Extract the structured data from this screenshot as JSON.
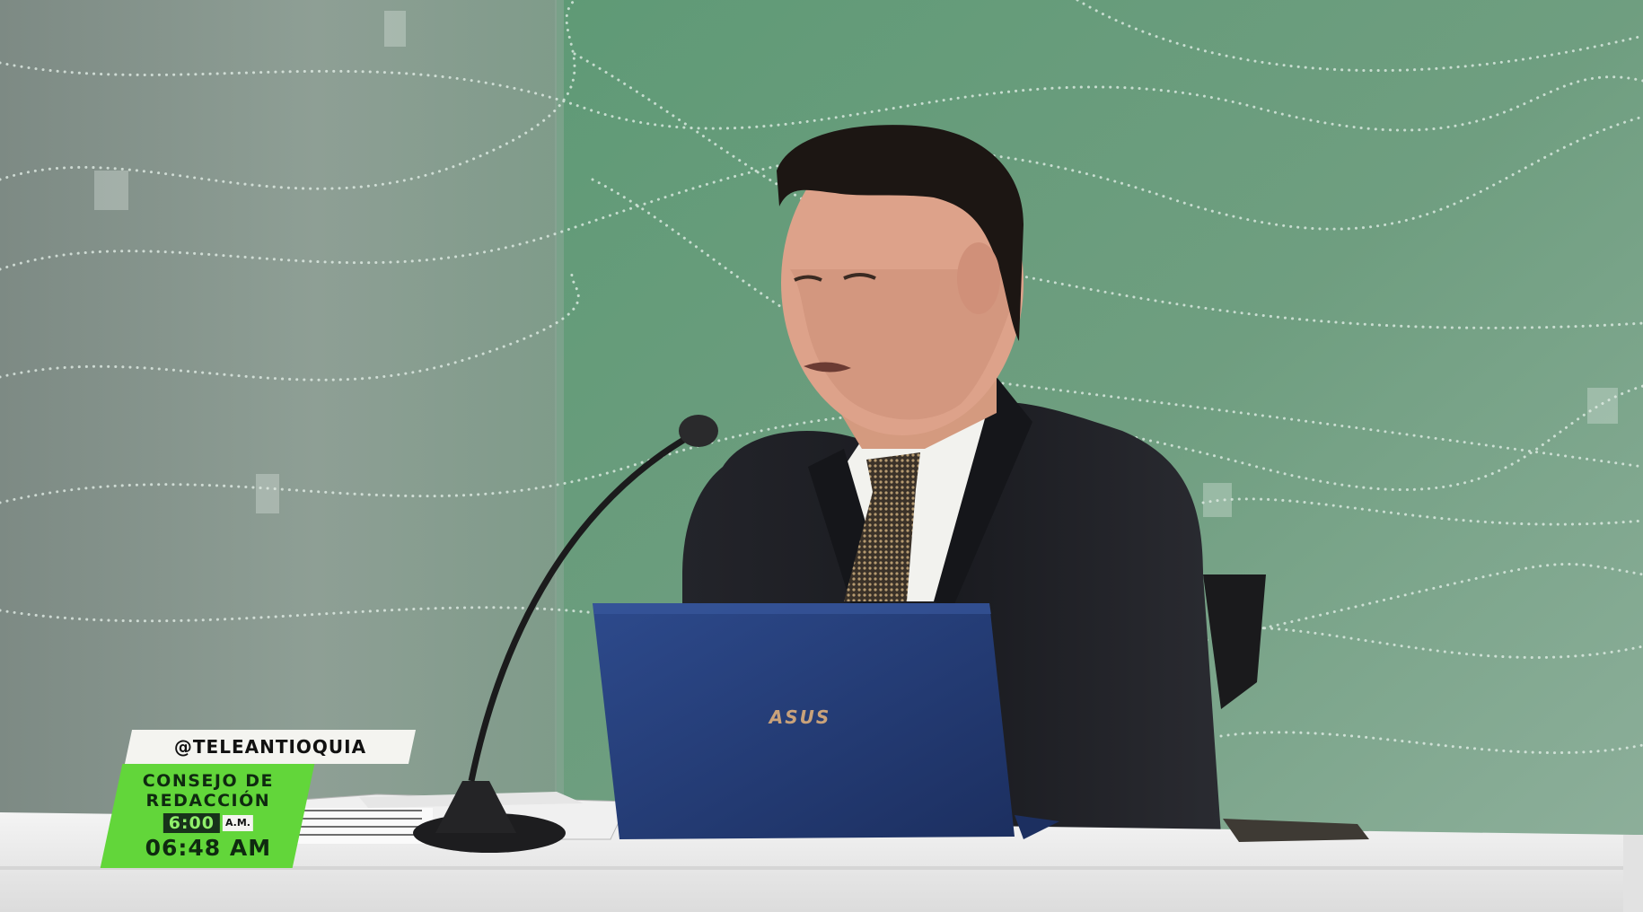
{
  "scene": {
    "laptop_brand": "ASUS"
  },
  "lower_third": {
    "handle": "@TELEANTIOQUIA",
    "show_title": "CONSEJO DE\nREDACCIÓN",
    "slot_time": "6:00",
    "slot_ampm": "A.M.",
    "clock": "06:48 AM"
  },
  "colors": {
    "bug_green": "#62d63a",
    "bug_dark": "#17331a",
    "backdrop_green": "#6f9a7f",
    "suit": "#1c1d22",
    "laptop_blue": "#243c78",
    "desk": "#ecebec"
  }
}
